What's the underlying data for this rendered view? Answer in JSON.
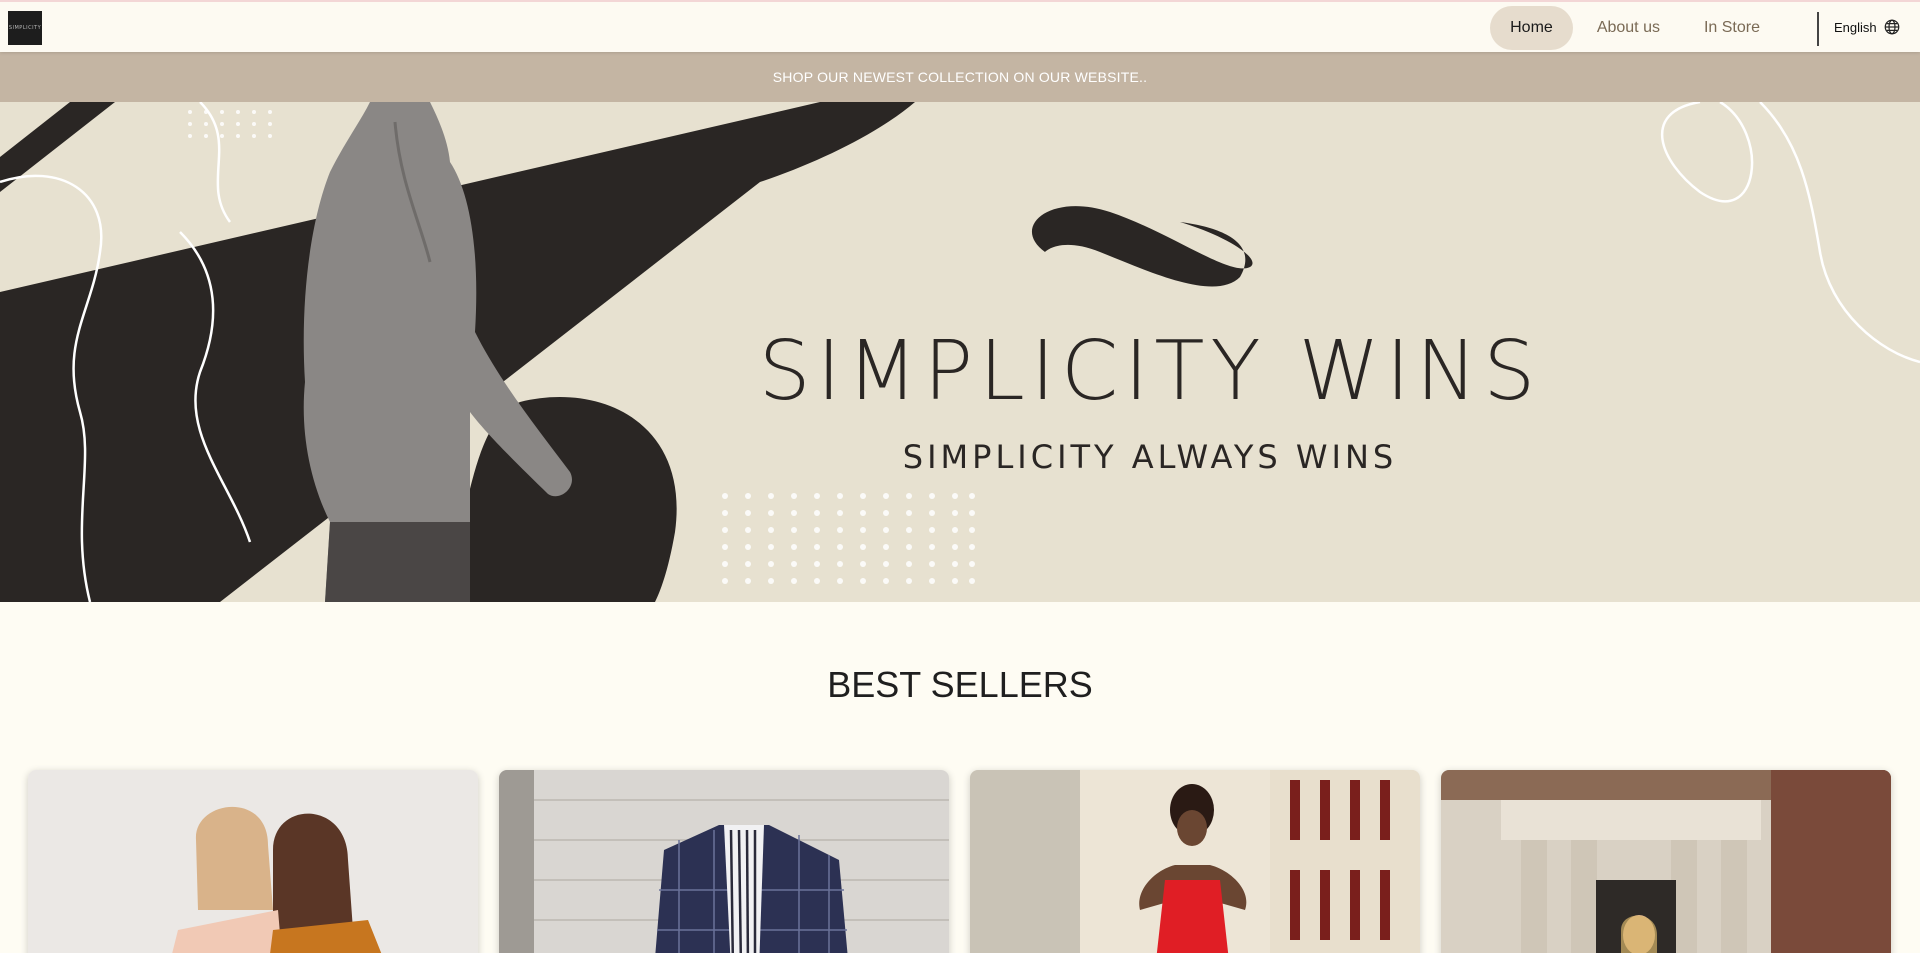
{
  "nav": {
    "logo_text": "SIMPLICITY",
    "links": [
      {
        "label": "Home",
        "active": true
      },
      {
        "label": "About us",
        "active": false
      },
      {
        "label": "In Store",
        "active": false
      }
    ],
    "language": "English"
  },
  "announcement": "SHOP OUR NEWEST COLLECTION ON OUR WEBSITE..",
  "hero": {
    "title": "SIMPLICITY WINS",
    "subtitle": "SIMPLICITY ALWAYS WINS"
  },
  "best_sellers": {
    "title": "BEST SELLERS",
    "cards": [
      {
        "name": "women-blazers-duo"
      },
      {
        "name": "plaid-suit-look"
      },
      {
        "name": "red-dress-look"
      },
      {
        "name": "street-style-look"
      }
    ]
  },
  "colors": {
    "background": "#fefcf3",
    "announcement_bar": "#c4b5a3",
    "hero_bg": "#e7e1d0",
    "active_pill": "#e6dccd",
    "dark": "#2a2624"
  }
}
